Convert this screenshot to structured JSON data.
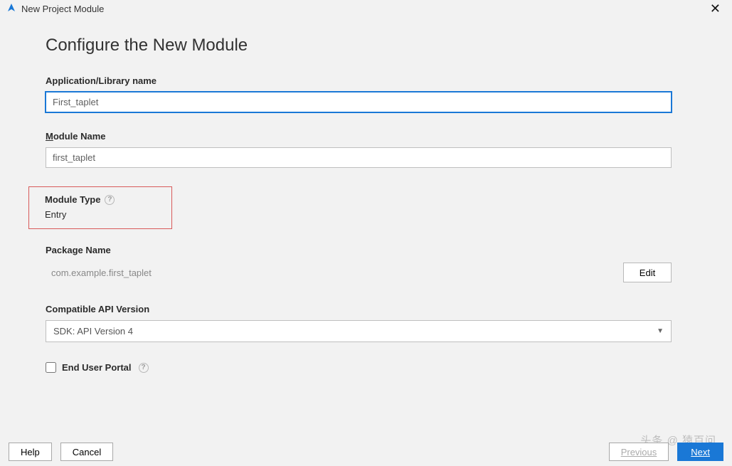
{
  "window": {
    "title": "New Project Module"
  },
  "heading": "Configure the New Module",
  "fields": {
    "appLibName": {
      "label": "Application/Library name",
      "value": "First_taplet"
    },
    "moduleName": {
      "label_pre": "M",
      "label_rest": "odule Name",
      "value": "first_taplet"
    },
    "moduleType": {
      "label": "Module Type",
      "value": "Entry"
    },
    "packageName": {
      "label": "Package Name",
      "value": "com.example.first_taplet",
      "editLabel": "Edit"
    },
    "apiVersion": {
      "label": "Compatible API Version",
      "selected": "SDK: API Version 4"
    },
    "endUserPortal": {
      "label": "End User Portal",
      "checked": false
    }
  },
  "footer": {
    "help": "Help",
    "cancel": "Cancel",
    "previous": "Previous",
    "next": "Next"
  },
  "watermark": "头条 @ 猿百问"
}
